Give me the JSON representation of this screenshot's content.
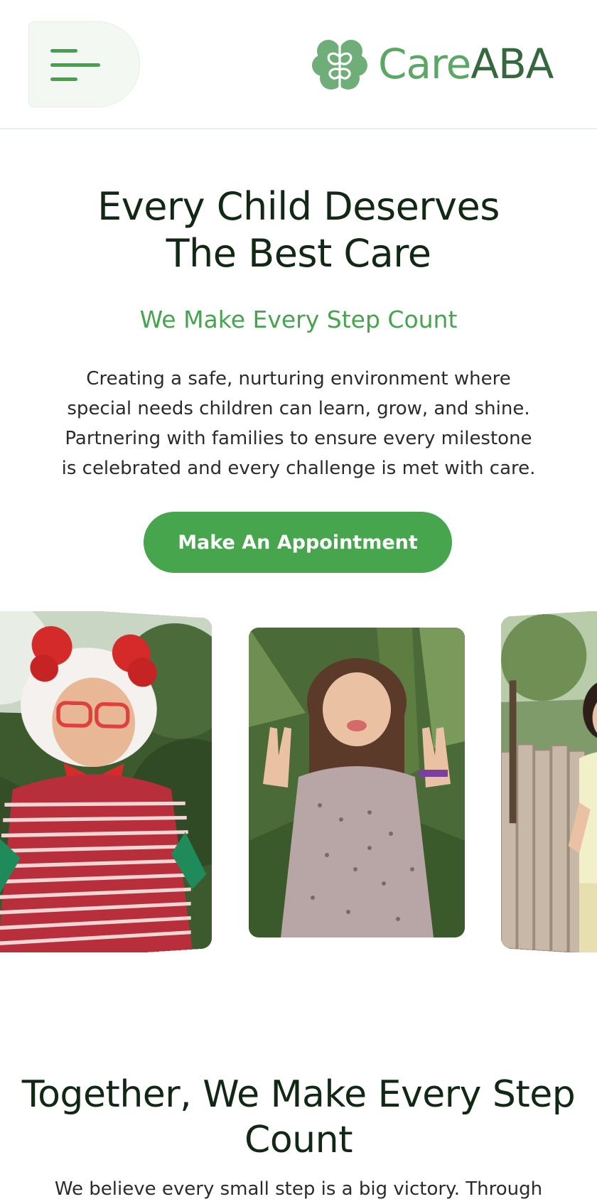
{
  "header": {
    "menu_icon": "hamburger-menu-icon",
    "logo_icon": "brain-icon",
    "logo_text_part1": "Care",
    "logo_text_part2": "ABA"
  },
  "hero": {
    "title_line1": "Every Child Deserves",
    "title_line2": "The Best Care",
    "subtitle": "We Make Every Step Count",
    "description_lines": [
      "Creating a safe, nurturing environment where",
      "special needs children can learn, grow, and shine.",
      "Partnering with families to ensure every milestone",
      "is celebrated and every challenge is met with care."
    ],
    "cta_label": "Make An Appointment"
  },
  "gallery": {
    "photos": [
      "child-with-reindeer-headband-photo",
      "child-making-peace-signs-photo",
      "child-by-fence-photo"
    ]
  },
  "section": {
    "title_line1": "Together, We Make Every Step",
    "title_line2": "Count",
    "description_start": "We believe every small step is a big victory. Through"
  },
  "colors": {
    "brand_green": "#46a54d",
    "logo_light": "#5aa864",
    "logo_dark": "#35683c",
    "heading": "#112814"
  }
}
